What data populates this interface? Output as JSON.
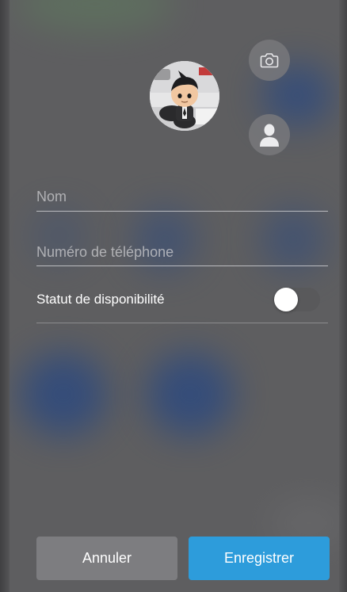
{
  "form": {
    "name_placeholder": "Nom",
    "name_value": "",
    "phone_placeholder": "Numéro de téléphone",
    "phone_value": "",
    "status_label": "Statut de disponibilité",
    "status_enabled": false
  },
  "actions": {
    "cancel_label": "Annuler",
    "save_label": "Enregistrer"
  },
  "icons": {
    "camera": "camera-icon",
    "contact": "person-icon"
  },
  "colors": {
    "save_button": "#2d9cdb",
    "cancel_button": "#7d7d80",
    "background": "#5e5e60"
  }
}
